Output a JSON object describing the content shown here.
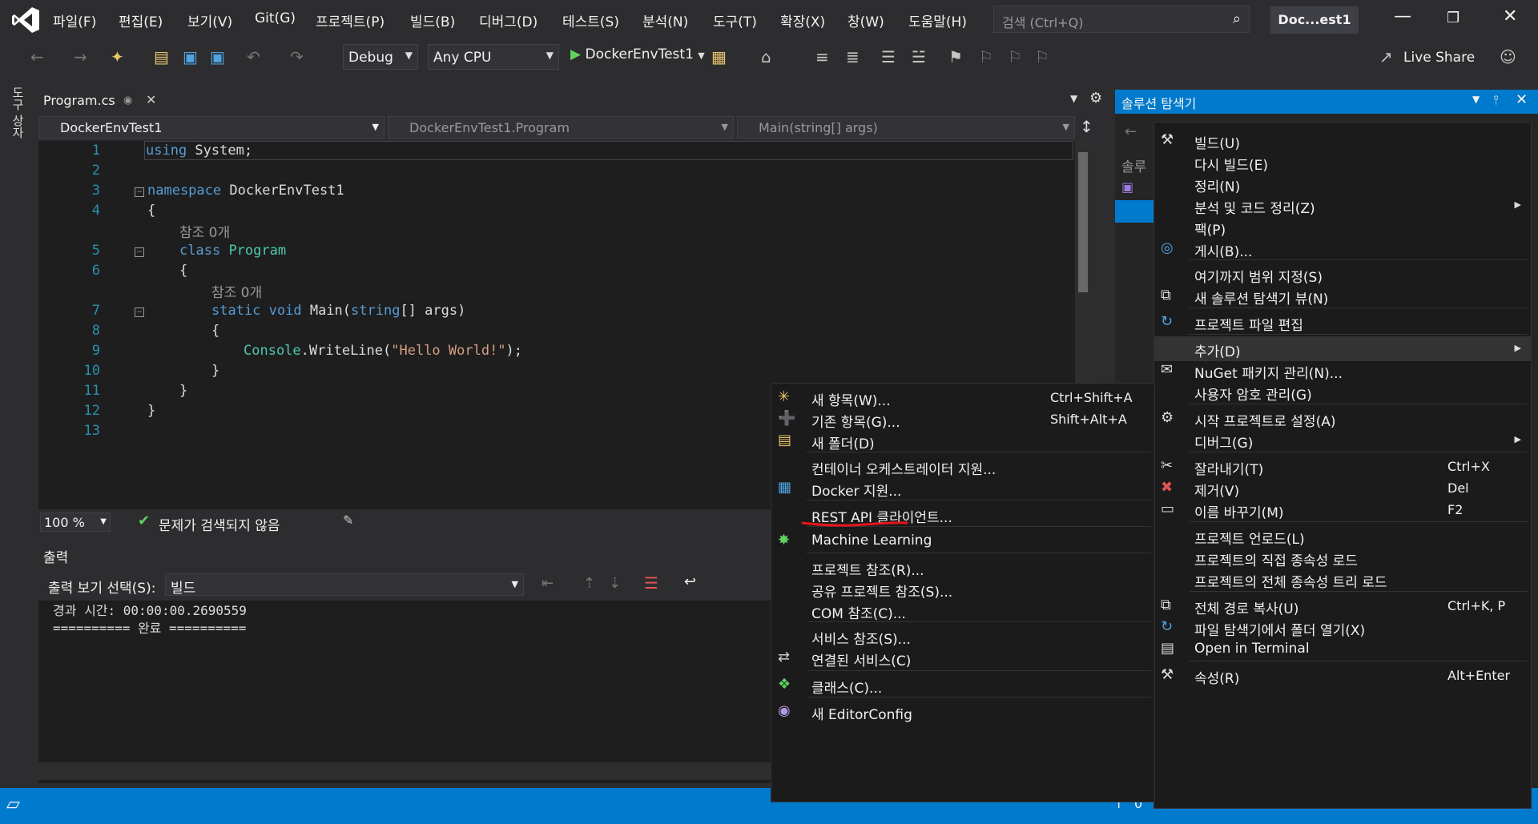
{
  "title_bar": {
    "menus": [
      "파일(F)",
      "편집(E)",
      "보기(V)",
      "Git(G)",
      "프로젝트(P)",
      "빌드(B)",
      "디버그(D)",
      "테스트(S)",
      "분석(N)",
      "도구(T)",
      "확장(X)",
      "창(W)",
      "도움말(H)"
    ],
    "search_placeholder": "검색 (Ctrl+Q)",
    "solution_name": "Doc...est1",
    "accent": "#007acc"
  },
  "toolbar": {
    "config": "Debug",
    "platform": "Any CPU",
    "run_target": "DockerEnvTest1",
    "live_share": "Live Share"
  },
  "left_strip": {
    "toolbox": "도구 상자"
  },
  "editor": {
    "tab": "Program.cs",
    "nav_project": "DockerEnvTest1",
    "nav_class": "DockerEnvTest1.Program",
    "nav_member": "Main(string[] args)",
    "zoom": "100 %",
    "issues": "문제가 검색되지 않음",
    "ref_count": "참조 0개",
    "code": {
      "l1_kw": "using",
      "l1_rest": " System;",
      "l3_kw": "namespace",
      "l3_rest": " DockerEnvTest1",
      "brace_open": "{",
      "brace_close": "}",
      "l5_kw": "class",
      "l5_ty": "Program",
      "l7_kw": "static void",
      "l7_name": " Main(",
      "l7_type": "string",
      "l7_rest": "[] args)",
      "l9_ty": "Console",
      "l9_mid": ".WriteLine(",
      "l9_str": "\"Hello World!\"",
      "l9_end": ");"
    },
    "line_numbers": [
      "1",
      "2",
      "3",
      "4",
      "5",
      "6",
      "7",
      "8",
      "9",
      "10",
      "11",
      "12",
      "13"
    ]
  },
  "output": {
    "title": "출력",
    "source_label": "출력 보기 선택(S):",
    "source_value": "빌드",
    "lines": "경과 시간: 00:00:00.2690559\n========== 완료 =========="
  },
  "solution_explorer": {
    "title": "솔루션 탐색기",
    "search_stub": "솔루"
  },
  "project_menu": [
    {
      "icon": "build-icon",
      "label": "빌드(U)",
      "shortcut": ""
    },
    {
      "icon": "",
      "label": "다시 빌드(E)",
      "shortcut": ""
    },
    {
      "icon": "",
      "label": "정리(N)",
      "shortcut": ""
    },
    {
      "icon": "",
      "label": "분석 및 코드 정리(Z)",
      "shortcut": ""
    },
    {
      "icon": "",
      "label": "팩(P)",
      "shortcut": ""
    },
    {
      "icon": "globe-icon",
      "label": "게시(B)...",
      "shortcut": ""
    },
    {
      "icon": "",
      "label": "여기까지 범위 지정(S)",
      "shortcut": ""
    },
    {
      "icon": "new-view-icon",
      "label": "새 솔루션 탐색기 뷰(N)",
      "shortcut": ""
    },
    {
      "icon": "refresh-icon",
      "label": "프로젝트 파일 편집",
      "shortcut": ""
    },
    {
      "icon": "",
      "label": "추가(D)",
      "shortcut": ""
    },
    {
      "icon": "nuget-icon",
      "label": "NuGet 패키지 관리(N)...",
      "shortcut": ""
    },
    {
      "icon": "",
      "label": "사용자 암호 관리(G)",
      "shortcut": ""
    },
    {
      "icon": "gear-icon",
      "label": "시작 프로젝트로 설정(A)",
      "shortcut": ""
    },
    {
      "icon": "",
      "label": "디버그(G)",
      "shortcut": ""
    },
    {
      "icon": "scissors-icon",
      "label": "잘라내기(T)",
      "shortcut": "Ctrl+X"
    },
    {
      "icon": "delete-icon",
      "label": "제거(V)",
      "shortcut": "Del"
    },
    {
      "icon": "rename-icon",
      "label": "이름 바꾸기(M)",
      "shortcut": "F2"
    },
    {
      "icon": "",
      "label": "프로젝트 언로드(L)",
      "shortcut": ""
    },
    {
      "icon": "",
      "label": "프로젝트의 직접 종속성 로드",
      "shortcut": ""
    },
    {
      "icon": "",
      "label": "프로젝트의 전체 종속성 트리 로드",
      "shortcut": ""
    },
    {
      "icon": "copy-icon",
      "label": "전체 경로 복사(U)",
      "shortcut": "Ctrl+K, P"
    },
    {
      "icon": "refresh-icon",
      "label": "파일 탐색기에서 폴더 열기(X)",
      "shortcut": ""
    },
    {
      "icon": "terminal-icon",
      "label": "Open in Terminal",
      "shortcut": ""
    },
    {
      "icon": "wrench-icon",
      "label": "속성(R)",
      "shortcut": "Alt+Enter"
    }
  ],
  "add_menu": [
    {
      "icon": "new-item-icon",
      "label": "새 항목(W)...",
      "shortcut": "Ctrl+Shift+A"
    },
    {
      "icon": "existing-item-icon",
      "label": "기존 항목(G)...",
      "shortcut": "Shift+Alt+A"
    },
    {
      "icon": "folder-icon",
      "label": "새 폴더(D)",
      "shortcut": ""
    },
    {
      "icon": "",
      "label": "컨테이너 오케스트레이터 지원...",
      "shortcut": ""
    },
    {
      "icon": "docker-icon",
      "label": "Docker 지원...",
      "shortcut": ""
    },
    {
      "icon": "",
      "label": "REST API 클라이언트...",
      "shortcut": ""
    },
    {
      "icon": "ml-icon",
      "label": "Machine Learning",
      "shortcut": ""
    },
    {
      "icon": "",
      "label": "프로젝트 참조(R)...",
      "shortcut": ""
    },
    {
      "icon": "",
      "label": "공유 프로젝트 참조(S)...",
      "shortcut": ""
    },
    {
      "icon": "",
      "label": "COM 참조(C)...",
      "shortcut": ""
    },
    {
      "icon": "",
      "label": "서비스 참조(S)...",
      "shortcut": ""
    },
    {
      "icon": "connected-service-icon",
      "label": "연결된 서비스(C)",
      "shortcut": ""
    },
    {
      "icon": "class-icon",
      "label": "클래스(C)...",
      "shortcut": ""
    },
    {
      "icon": "lightbulb-icon",
      "label": "새 EditorConfig",
      "shortcut": ""
    }
  ],
  "status_bar": {
    "counter": "0"
  }
}
